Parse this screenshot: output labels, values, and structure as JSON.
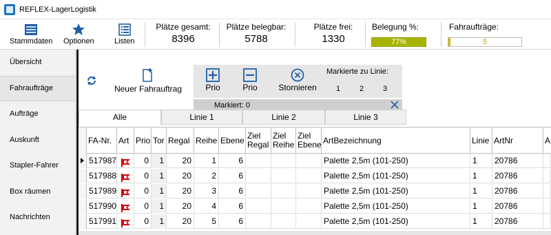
{
  "window": {
    "title": "REFLEX-LagerLogistik"
  },
  "toolbar": {
    "buttons": [
      {
        "label": "Stammdaten",
        "icon": "database-icon"
      },
      {
        "label": "Optionen",
        "icon": "star-icon"
      },
      {
        "label": "Listen",
        "icon": "list-icon"
      }
    ],
    "stats": [
      {
        "label": "Plätze gesamt:",
        "value": "8396"
      },
      {
        "label": "Plätze belegbar:",
        "value": "5788"
      },
      {
        "label": "Plätze frei:",
        "value": "1330"
      }
    ],
    "belegung": {
      "label": "Belegung %:",
      "value": "77%",
      "fraction": 0.77,
      "color": "#a8b400"
    },
    "fahrauftraege": {
      "label": "Fahraufträge:",
      "value": "5",
      "color": "#b9a200"
    }
  },
  "nav": {
    "items": [
      {
        "label": "Übersicht"
      },
      {
        "label": "Fahraufträge"
      },
      {
        "label": "Aufträge"
      },
      {
        "label": "Auskunft"
      },
      {
        "label": "Stapler-Fahrer"
      },
      {
        "label": "Box räumen"
      },
      {
        "label": "Nachrichten"
      }
    ]
  },
  "commands": {
    "new_label": "Neuer Fahrauftrag",
    "prio_up_label": "Prio",
    "prio_down_label": "Prio",
    "cancel_label": "Stornieren",
    "mark_line_label": "Markierte zu Linie:",
    "line_buttons": [
      "1",
      "2",
      "3"
    ],
    "marked_label": "Markiert: 0"
  },
  "tabs": [
    "Alle",
    "Linie 1",
    "Linie 2",
    "Linie 3"
  ],
  "grid": {
    "columns": [
      {
        "h1": "FA-Nr.",
        "h2": ""
      },
      {
        "h1": "Art",
        "h2": ""
      },
      {
        "h1": "Prio",
        "h2": ""
      },
      {
        "h1": "Tor",
        "h2": ""
      },
      {
        "h1": "Regal",
        "h2": ""
      },
      {
        "h1": "Reihe",
        "h2": ""
      },
      {
        "h1": "Ebene",
        "h2": ""
      },
      {
        "h1": "Ziel",
        "h2": "Regal"
      },
      {
        "h1": "Ziel",
        "h2": "Reihe"
      },
      {
        "h1": "Ziel",
        "h2": "Ebene"
      },
      {
        "h1": "ArtBezeichnung",
        "h2": ""
      },
      {
        "h1": "Linie",
        "h2": ""
      },
      {
        "h1": "ArtNr",
        "h2": ""
      },
      {
        "h1": "A",
        "h2": ""
      }
    ],
    "rows": [
      {
        "fa": "517987",
        "prio": "0",
        "tor": "1",
        "regal": "20",
        "reihe": "1",
        "ebene": "6",
        "bez": "Palette 2,5m (101-250)",
        "linie": "1",
        "artnr": "20786"
      },
      {
        "fa": "517988",
        "prio": "0",
        "tor": "1",
        "regal": "20",
        "reihe": "2",
        "ebene": "6",
        "bez": "Palette 2,5m (101-250)",
        "linie": "1",
        "artnr": "20786"
      },
      {
        "fa": "517989",
        "prio": "0",
        "tor": "1",
        "regal": "20",
        "reihe": "3",
        "ebene": "6",
        "bez": "Palette 2,5m (101-250)",
        "linie": "1",
        "artnr": "20786"
      },
      {
        "fa": "517990",
        "prio": "0",
        "tor": "1",
        "regal": "20",
        "reihe": "4",
        "ebene": "6",
        "bez": "Palette 2,5m (101-250)",
        "linie": "1",
        "artnr": "20786"
      },
      {
        "fa": "517991",
        "prio": "0",
        "tor": "1",
        "regal": "20",
        "reihe": "5",
        "ebene": "6",
        "bez": "Palette 2,5m (101-250)",
        "linie": "1",
        "artnr": "20786"
      }
    ]
  }
}
